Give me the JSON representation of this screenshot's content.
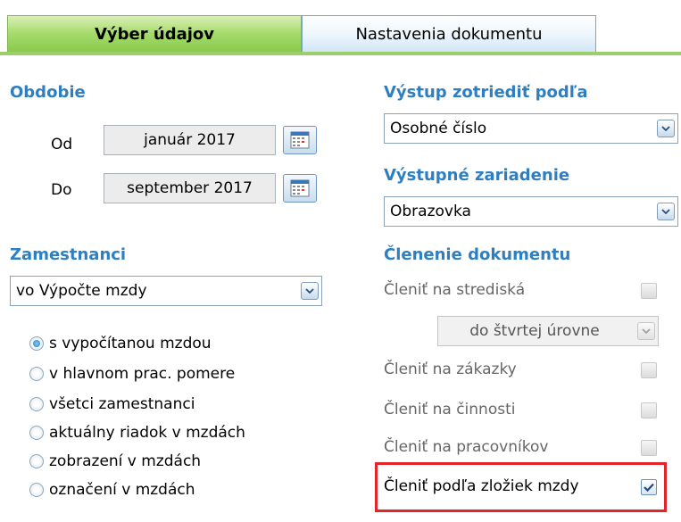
{
  "tabs": [
    {
      "label": "Výber údajov",
      "active": true
    },
    {
      "label": "Nastavenia dokumentu",
      "active": false
    }
  ],
  "obdobie": {
    "title": "Obdobie",
    "od_label": "Od",
    "od_value": "január 2017",
    "do_label": "Do",
    "do_value": "september 2017"
  },
  "zamestnanci": {
    "title": "Zamestnanci",
    "selected": "vo Výpočte mzdy",
    "options": [
      {
        "label": "s vypočítanou mzdou",
        "selected": true
      },
      {
        "label": "v hlavnom prac. pomere",
        "selected": false
      },
      {
        "label": "všetci zamestnanci",
        "selected": false
      },
      {
        "label": "aktuálny riadok v mzdách",
        "selected": false
      },
      {
        "label": "zobrazení v mzdách",
        "selected": false
      },
      {
        "label": "označení v mzdách",
        "selected": false
      }
    ]
  },
  "vystup_zotriedit": {
    "title": "Výstup zotriediť podľa",
    "selected": "Osobné číslo"
  },
  "vystupne_zariadenie": {
    "title": "Výstupné zariadenie",
    "selected": "Obrazovka"
  },
  "clenenie": {
    "title": "Členenie dokumentu",
    "strediska_label": "Členiť na strediská",
    "uroven_selected": "do štvrtej úrovne",
    "zakazky_label": "Členiť na zákazky",
    "cinnosti_label": "Členiť na činnosti",
    "pracovnikov_label": "Členiť na pracovníkov",
    "zlozky_label": "Členiť podľa zložiek mzdy",
    "zlozky_checked": true
  },
  "colors": {
    "section_title": "#2e7fc1",
    "active_tab": "#a8dc6e",
    "highlight": "#e3242b"
  }
}
